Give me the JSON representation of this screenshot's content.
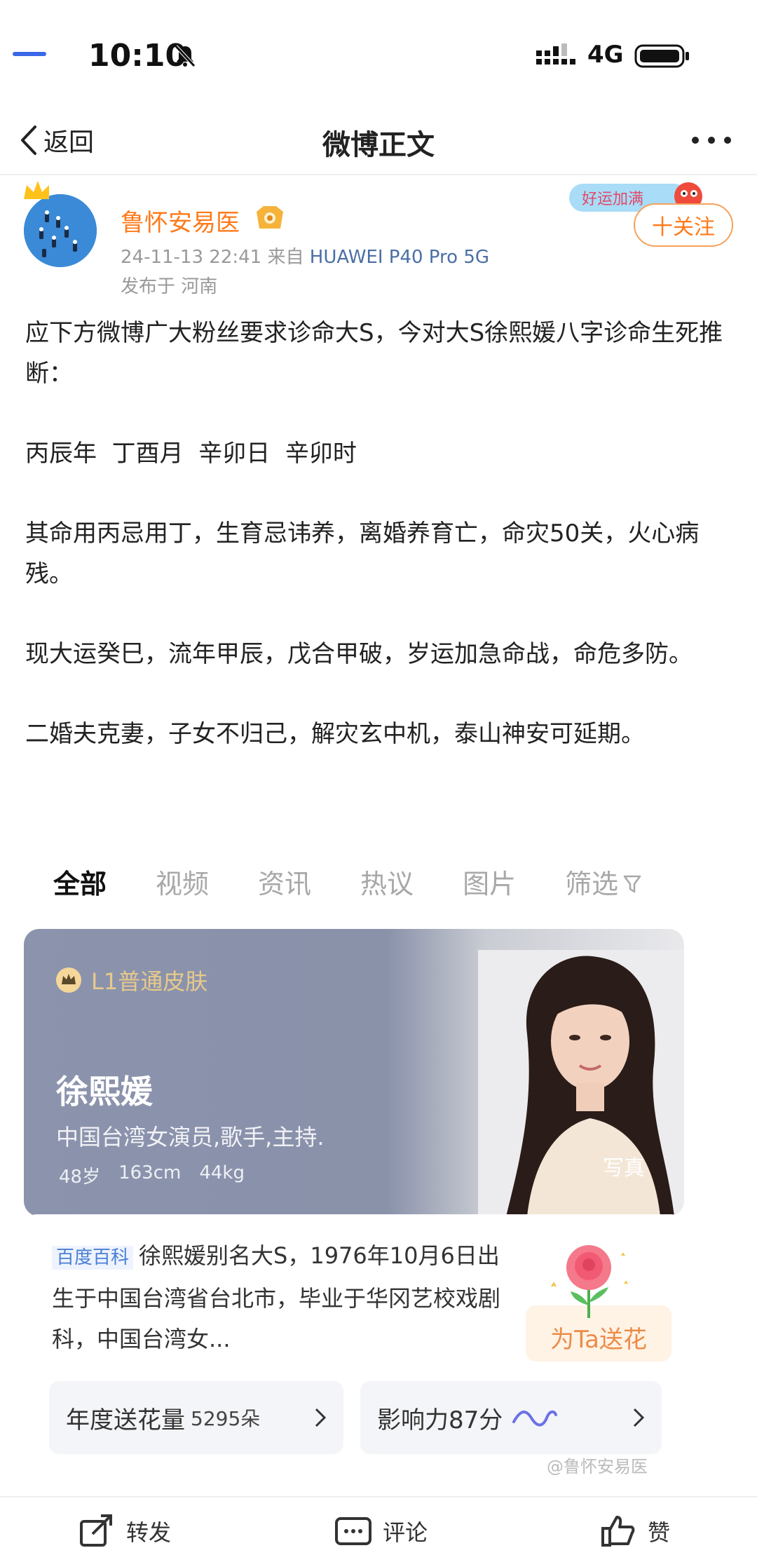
{
  "status_bar": {
    "time": "10:10",
    "network": "4G"
  },
  "nav": {
    "back_label": "返回",
    "title": "微博正文"
  },
  "author": {
    "name": "鲁怀安易医",
    "date": "24-11-13 22:41",
    "from_label": "来自",
    "device": "HUAWEI P40 Pro 5G",
    "location": "发布于 河南",
    "follow_label": "十关注",
    "badge_text": "好运加满"
  },
  "post": {
    "paragraphs": [
      "应下方微博广大粉丝要求诊命大S，今对大S徐熙媛八字诊命生死推断：",
      "丙辰年  丁酉月  辛卯日  辛卯时",
      "其命用丙忌用丁，生育忌讳养，离婚养育亡，命灾50关，火心病残。",
      "现大运癸巳，流年甲辰，戊合甲破，岁运加急命战，命危多防。",
      "二婚夫克妻，子女不归己，解灾玄中机，泰山神安可延期。"
    ]
  },
  "embed": {
    "tabs": [
      "全部",
      "视频",
      "资讯",
      "热议",
      "图片",
      "筛选"
    ],
    "active_tab": 0,
    "skin_label": "L1普通皮肤",
    "person_name": "徐熙媛",
    "person_desc": "中国台湾女演员,歌手,主持.",
    "stats": [
      "48岁",
      "163cm",
      "44kg"
    ],
    "photo_label": "写真",
    "baike_tag": "百度百科",
    "baike_text": "徐熙媛别名大S，1976年10月6日出生于中国台湾省台北市，毕业于华冈艺校戏剧科，中国台湾女...",
    "send_flower": "为Ta送花",
    "flower_label": "年度送花量",
    "flower_count": "5295朵",
    "influence_label": "影响力87分",
    "watermark": "@鲁怀安易医"
  },
  "actions": {
    "repost": "转发",
    "comment": "评论",
    "like": "赞"
  }
}
